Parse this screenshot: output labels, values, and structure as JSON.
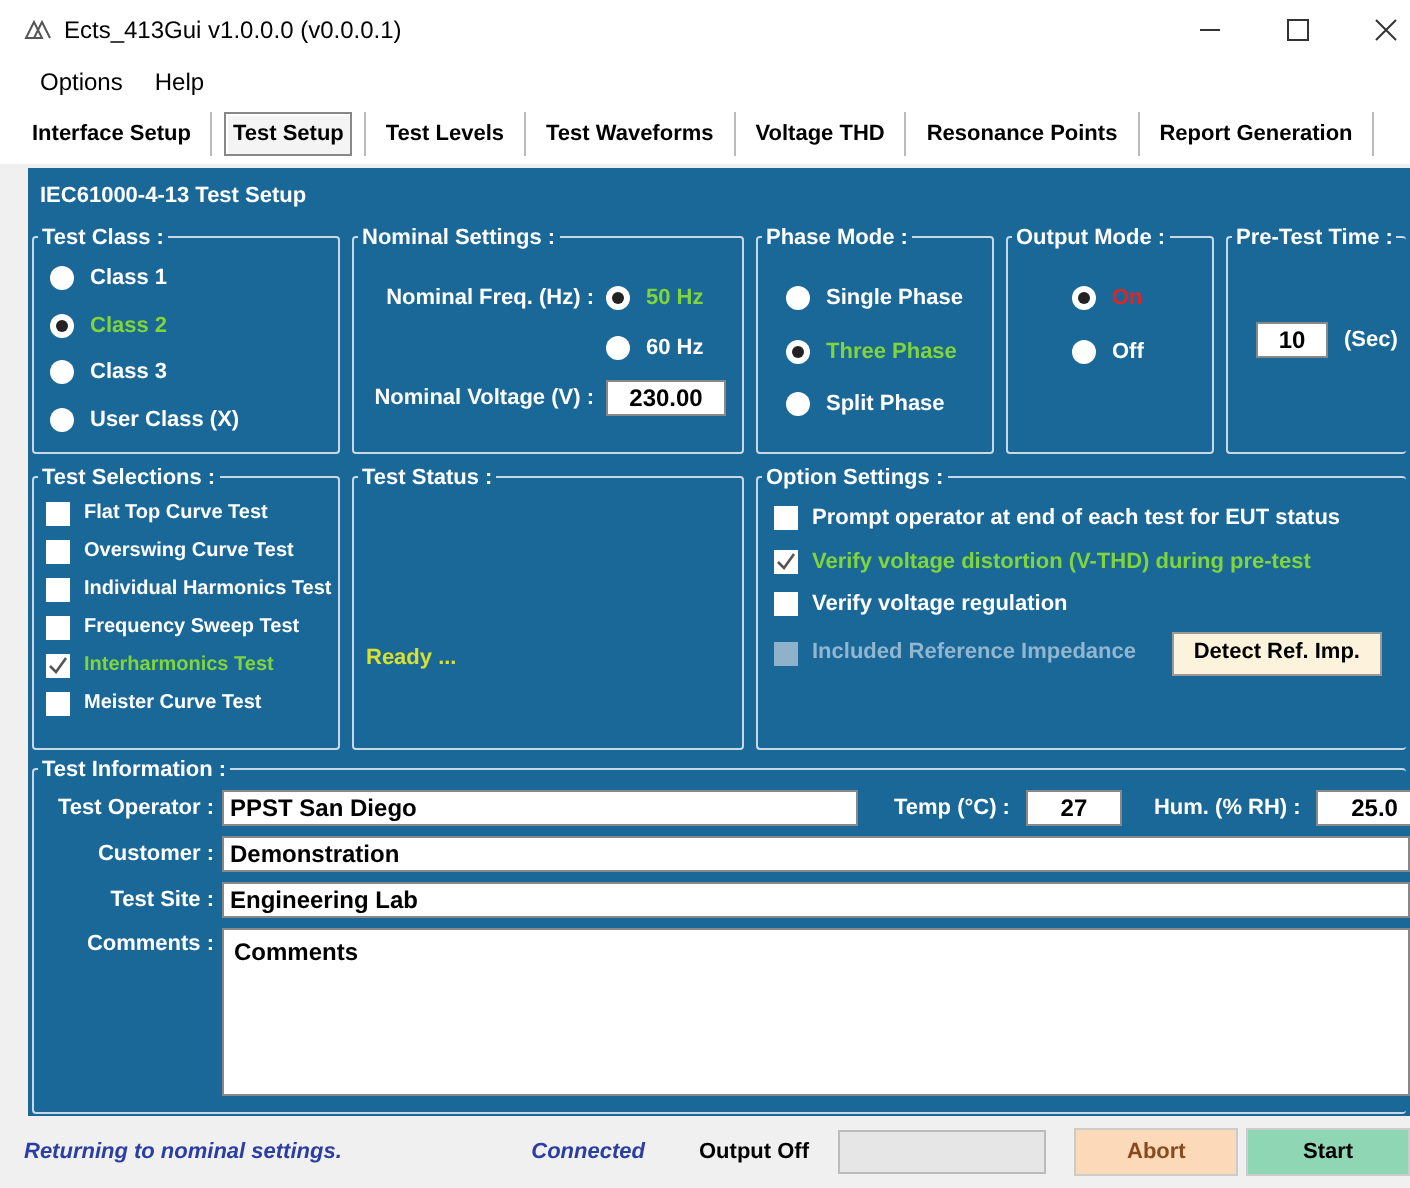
{
  "window": {
    "title": "Ects_413Gui v1.0.0.0 (v0.0.0.1)"
  },
  "menu": [
    "Options",
    "Help"
  ],
  "tabs": [
    {
      "label": "Interface Setup",
      "selected": false
    },
    {
      "label": "Test Setup",
      "selected": true
    },
    {
      "label": "Test Levels",
      "selected": false
    },
    {
      "label": "Test Waveforms",
      "selected": false
    },
    {
      "label": "Voltage THD",
      "selected": false
    },
    {
      "label": "Resonance Points",
      "selected": false
    },
    {
      "label": "Report Generation",
      "selected": false
    }
  ],
  "panel_title": "IEC61000-4-13 Test Setup",
  "test_class": {
    "title": "Test Class :",
    "options": [
      {
        "label": "Class 1",
        "selected": false
      },
      {
        "label": "Class 2",
        "selected": true
      },
      {
        "label": "Class 3",
        "selected": false
      },
      {
        "label": "User Class (X)",
        "selected": false
      }
    ]
  },
  "nominal_settings": {
    "title": "Nominal Settings :",
    "freq_label": "Nominal Freq. (Hz) :",
    "freq_options": [
      {
        "label": "50 Hz",
        "selected": true
      },
      {
        "label": "60 Hz",
        "selected": false
      }
    ],
    "voltage_label": "Nominal Voltage (V) :",
    "voltage": "230.00"
  },
  "phase_mode": {
    "title": "Phase Mode :",
    "options": [
      {
        "label": "Single Phase",
        "selected": false
      },
      {
        "label": "Three Phase",
        "selected": true
      },
      {
        "label": "Split Phase",
        "selected": false
      }
    ]
  },
  "output_mode": {
    "title": "Output Mode :",
    "options": [
      {
        "label": "On",
        "selected": true
      },
      {
        "label": "Off",
        "selected": false
      }
    ]
  },
  "pre_test_time": {
    "title": "Pre-Test Time :",
    "value": "10",
    "unit": "(Sec)"
  },
  "test_selections": {
    "title": "Test Selections :",
    "items": [
      {
        "label": "Flat Top Curve Test",
        "checked": false
      },
      {
        "label": "Overswing Curve Test",
        "checked": false
      },
      {
        "label": "Individual Harmonics Test",
        "checked": false
      },
      {
        "label": "Frequency Sweep Test",
        "checked": false
      },
      {
        "label": "Interharmonics Test",
        "checked": true
      },
      {
        "label": "Meister Curve Test",
        "checked": false
      }
    ]
  },
  "test_status": {
    "title": "Test Status :",
    "message": "Ready ..."
  },
  "option_settings": {
    "title": "Option Settings :",
    "items": [
      {
        "label": "Prompt operator at end of each test for EUT status",
        "checked": false,
        "disabled": false
      },
      {
        "label": "Verify voltage distortion (V-THD) during pre-test",
        "checked": true,
        "disabled": false
      },
      {
        "label": "Verify voltage regulation",
        "checked": false,
        "disabled": false
      },
      {
        "label": "Included Reference Impedance",
        "checked": false,
        "disabled": true
      }
    ],
    "button": "Detect Ref. Imp."
  },
  "test_information": {
    "title": "Test Information :",
    "operator_label": "Test Operator :",
    "operator": "PPST San Diego",
    "temp_label": "Temp (°C) :",
    "temp": "27",
    "hum_label": "Hum. (% RH) :",
    "hum": "25.0",
    "customer_label": "Customer :",
    "customer": "Demonstration",
    "site_label": "Test Site :",
    "site": "Engineering Lab",
    "comments_label": "Comments :",
    "comments": "Comments"
  },
  "status_bar": {
    "message": "Returning to nominal settings.",
    "connection": "Connected",
    "output": "Output Off",
    "abort": "Abort",
    "start": "Start"
  }
}
